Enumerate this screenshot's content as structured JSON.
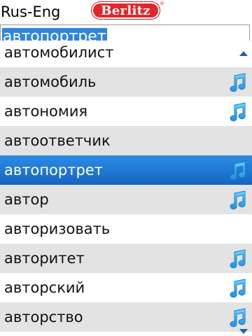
{
  "header": {
    "title": "Rus-Eng",
    "logo_text": "Berlitz",
    "logo_mark": "®"
  },
  "search": {
    "value": "автопортрет"
  },
  "list": {
    "items": [
      {
        "label": "автомобилист",
        "audio": false,
        "selected": false
      },
      {
        "label": "автомобиль",
        "audio": true,
        "selected": false
      },
      {
        "label": "автономия",
        "audio": true,
        "selected": false
      },
      {
        "label": "автоответчик",
        "audio": false,
        "selected": false
      },
      {
        "label": "автопортрет",
        "audio": true,
        "selected": true
      },
      {
        "label": "автор",
        "audio": true,
        "selected": false
      },
      {
        "label": "авторизовать",
        "audio": false,
        "selected": false
      },
      {
        "label": "авторитет",
        "audio": true,
        "selected": false
      },
      {
        "label": "авторский",
        "audio": true,
        "selected": false
      },
      {
        "label": "авторство",
        "audio": true,
        "selected": false
      }
    ],
    "audio_icon": "music-note-icon",
    "scroll_up_icon": "scroll-up-arrow-icon",
    "scroll_down_icon": "scroll-down-arrow-icon"
  },
  "colors": {
    "selection": "#1f78d8",
    "alt_row": "#e3e3e3",
    "brand_red": "#e3262a",
    "audio_icon": "#2aa7e8"
  }
}
